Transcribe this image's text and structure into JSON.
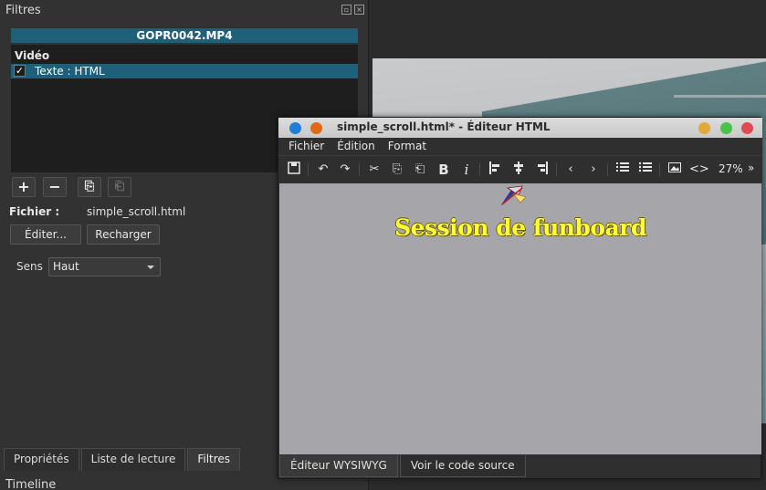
{
  "filters_dock": {
    "title": "Filtres",
    "clip_name": "GOPR0042.MP4",
    "category": "Vidéo",
    "filters": [
      {
        "label": "Texte : HTML",
        "checked": true,
        "check_glyph": "✓"
      }
    ],
    "toolbar": {
      "add_glyph": "+",
      "remove_glyph": "−",
      "copy_glyph": "⎘",
      "paste_glyph": "⎗"
    },
    "file_label": "Fichier :",
    "file_value": "simple_scroll.html",
    "edit_button": "Éditer...",
    "reload_button": "Recharger",
    "direction_label": "Sens",
    "direction_value": "Haut",
    "tabs": [
      "Propriétés",
      "Liste de lecture",
      "Filtres"
    ],
    "active_tab": "Filtres"
  },
  "timeline_label": "Timeline",
  "editor": {
    "title": "simple_scroll.html* - Éditeur HTML",
    "menu": [
      "Fichier",
      "Édition",
      "Format"
    ],
    "toolbar_icons": [
      "save-icon",
      "undo-icon",
      "redo-icon",
      "cut-icon",
      "copy-icon",
      "paste-icon",
      "bold-icon",
      "italic-icon",
      "align-left-icon",
      "align-center-icon",
      "align-right-icon",
      "outdent-icon",
      "indent-icon",
      "numbered-list-icon",
      "bullet-list-icon",
      "image-icon",
      "code-icon"
    ],
    "zoom": "27%",
    "content_heading": "Session de funboard",
    "tabs": [
      "Éditeur WYSIWYG",
      "Voir le code source"
    ],
    "active_tab": "Éditeur WYSIWYG",
    "colors": {
      "page_bg": "#a6a5aa",
      "heading": "#ffff33"
    }
  },
  "colors": {
    "selection": "#1f5f7a",
    "dock_bg": "#323232"
  }
}
